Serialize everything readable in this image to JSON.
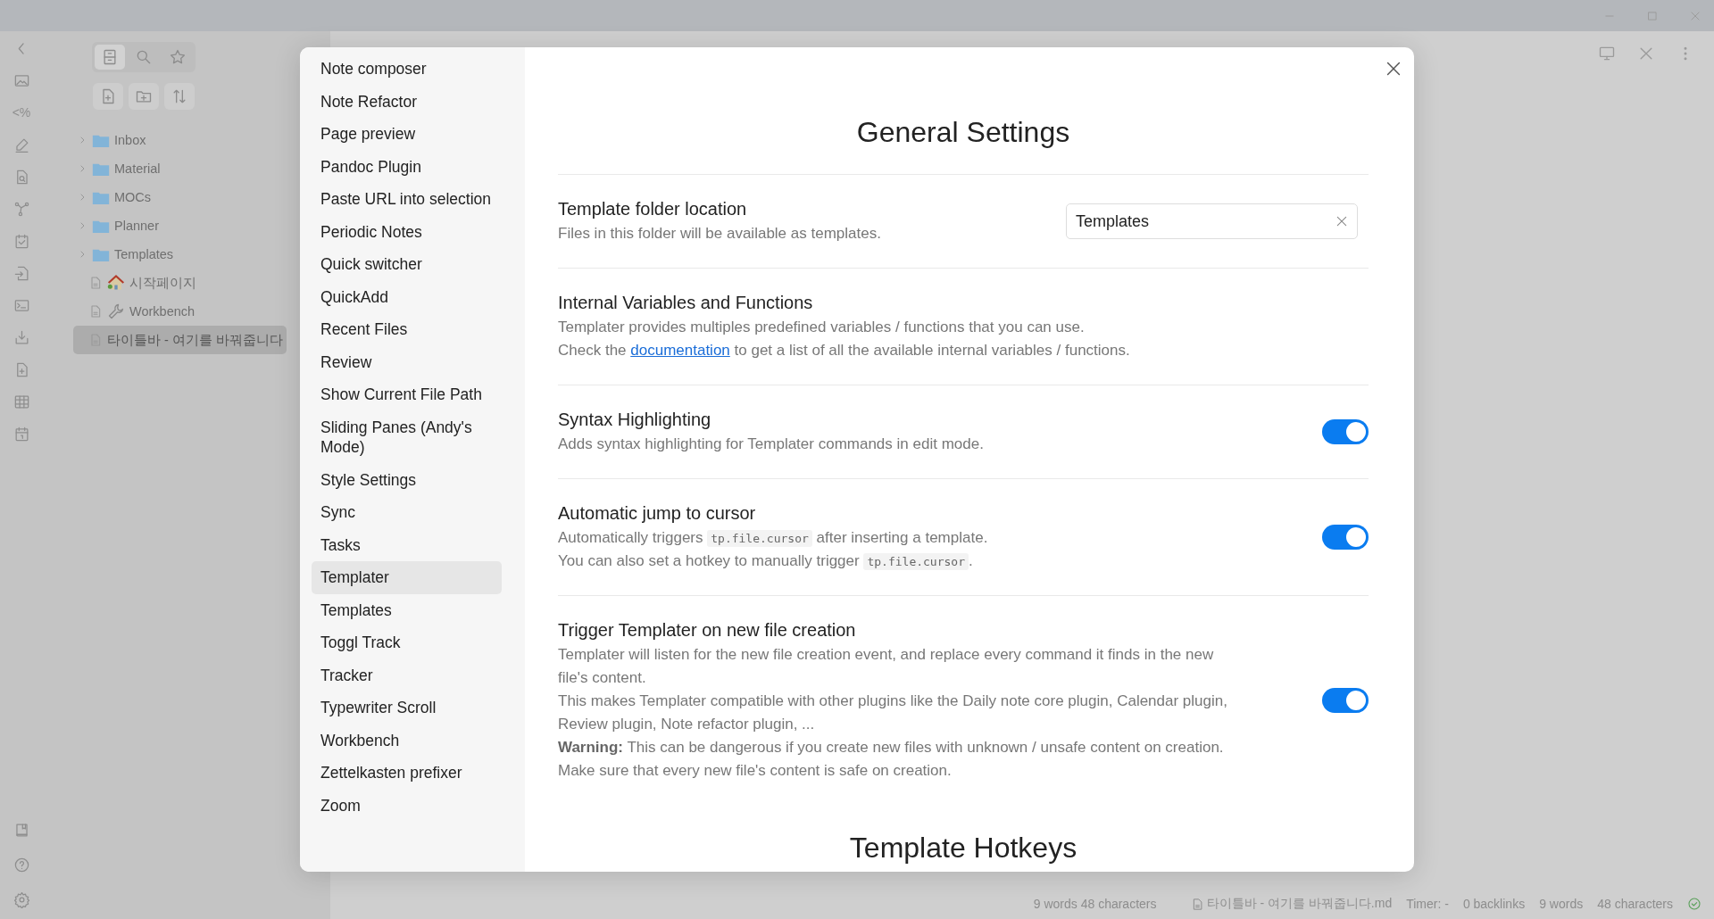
{
  "ribbon": {
    "glyph_button": "<%"
  },
  "sidebar": {
    "view_tabs": [
      {
        "selected": true
      },
      {
        "selected": false
      },
      {
        "selected": false
      }
    ],
    "file_tree": [
      {
        "kind": "folder",
        "label": "Inbox",
        "selected": false
      },
      {
        "kind": "folder",
        "label": "Material",
        "selected": false
      },
      {
        "kind": "folder",
        "label": "MOCs",
        "selected": false
      },
      {
        "kind": "folder",
        "label": "Planner",
        "selected": false
      },
      {
        "kind": "folder",
        "label": "Templates",
        "selected": false
      },
      {
        "kind": "file",
        "label": "시작페이지",
        "selected": false
      },
      {
        "kind": "file",
        "label": "Workbench",
        "selected": false
      },
      {
        "kind": "file",
        "label": "타이틀바 - 여기를 바꿔줍니다",
        "selected": true
      }
    ]
  },
  "status_bar": [
    {
      "kind": "text",
      "text": "9 words 48 characters"
    },
    {
      "kind": "file",
      "text": "타이틀바 - 여기를 바꿔줍니다.md"
    },
    {
      "kind": "text",
      "text": "Timer: -"
    },
    {
      "kind": "text",
      "text": "0 backlinks"
    },
    {
      "kind": "text",
      "text": "9 words"
    },
    {
      "kind": "text",
      "text": "48 characters"
    },
    {
      "kind": "sync"
    }
  ],
  "modal": {
    "nav": [
      {
        "label": "Note composer",
        "selected": false
      },
      {
        "label": "Note Refactor",
        "selected": false
      },
      {
        "label": "Page preview",
        "selected": false
      },
      {
        "label": "Pandoc Plugin",
        "selected": false
      },
      {
        "label": "Paste URL into selection",
        "selected": false
      },
      {
        "label": "Periodic Notes",
        "selected": false
      },
      {
        "label": "Quick switcher",
        "selected": false
      },
      {
        "label": "QuickAdd",
        "selected": false
      },
      {
        "label": "Recent Files",
        "selected": false
      },
      {
        "label": "Review",
        "selected": false
      },
      {
        "label": "Show Current File Path",
        "selected": false
      },
      {
        "label": "Sliding Panes (Andy's Mode)",
        "selected": false
      },
      {
        "label": "Style Settings",
        "selected": false
      },
      {
        "label": "Sync",
        "selected": false
      },
      {
        "label": "Tasks",
        "selected": false
      },
      {
        "label": "Templater",
        "selected": true
      },
      {
        "label": "Templates",
        "selected": false
      },
      {
        "label": "Toggl Track",
        "selected": false
      },
      {
        "label": "Tracker",
        "selected": false
      },
      {
        "label": "Typewriter Scroll",
        "selected": false
      },
      {
        "label": "Workbench",
        "selected": false
      },
      {
        "label": "Zettelkasten prefixer",
        "selected": false
      },
      {
        "label": "Zoom",
        "selected": false
      }
    ],
    "title": "General Settings",
    "settings": [
      {
        "kind": "text",
        "name": "Template folder location",
        "description": [
          [
            {
              "kind": "text",
              "text": "Files in this folder will be available as templates."
            }
          ]
        ],
        "value": "Templates"
      },
      {
        "kind": "info",
        "name": "Internal Variables and Functions",
        "description": [
          [
            {
              "kind": "text",
              "text": "Templater provides multiples predefined variables / functions that you can use."
            }
          ],
          [
            {
              "kind": "text",
              "text": "Check the "
            },
            {
              "kind": "link",
              "text": "documentation"
            },
            {
              "kind": "text",
              "text": " to get a list of all the available internal variables / functions."
            }
          ]
        ]
      },
      {
        "kind": "toggle",
        "name": "Syntax Highlighting",
        "description": [
          [
            {
              "kind": "text",
              "text": "Adds syntax highlighting for Templater commands in edit mode."
            }
          ]
        ],
        "on": true
      },
      {
        "kind": "toggle",
        "name": "Automatic jump to cursor",
        "description": [
          [
            {
              "kind": "text",
              "text": "Automatically triggers "
            },
            {
              "kind": "code",
              "text": "tp.file.cursor"
            },
            {
              "kind": "text",
              "text": " after inserting a template."
            }
          ],
          [
            {
              "kind": "text",
              "text": "You can also set a hotkey to manually trigger "
            },
            {
              "kind": "code",
              "text": "tp.file.cursor"
            },
            {
              "kind": "text",
              "text": "."
            }
          ]
        ],
        "on": true
      },
      {
        "kind": "toggle",
        "name": "Trigger Templater on new file creation",
        "description": [
          [
            {
              "kind": "text",
              "text": "Templater will listen for the new file creation event, and replace every command it finds in the new file's content."
            }
          ],
          [
            {
              "kind": "text",
              "text": "This makes Templater compatible with other plugins like the Daily note core plugin, Calendar plugin, Review plugin, Note refactor plugin, ..."
            }
          ],
          [
            {
              "kind": "text",
              "text": "**Warning:** This can be dangerous if you create new files with unknown / unsafe content on creation."
            }
          ],
          [
            {
              "kind": "text",
              "text": "Make sure that every new file's content is safe on creation."
            }
          ]
        ],
        "on": true
      }
    ],
    "next_heading": "Template Hotkeys"
  }
}
